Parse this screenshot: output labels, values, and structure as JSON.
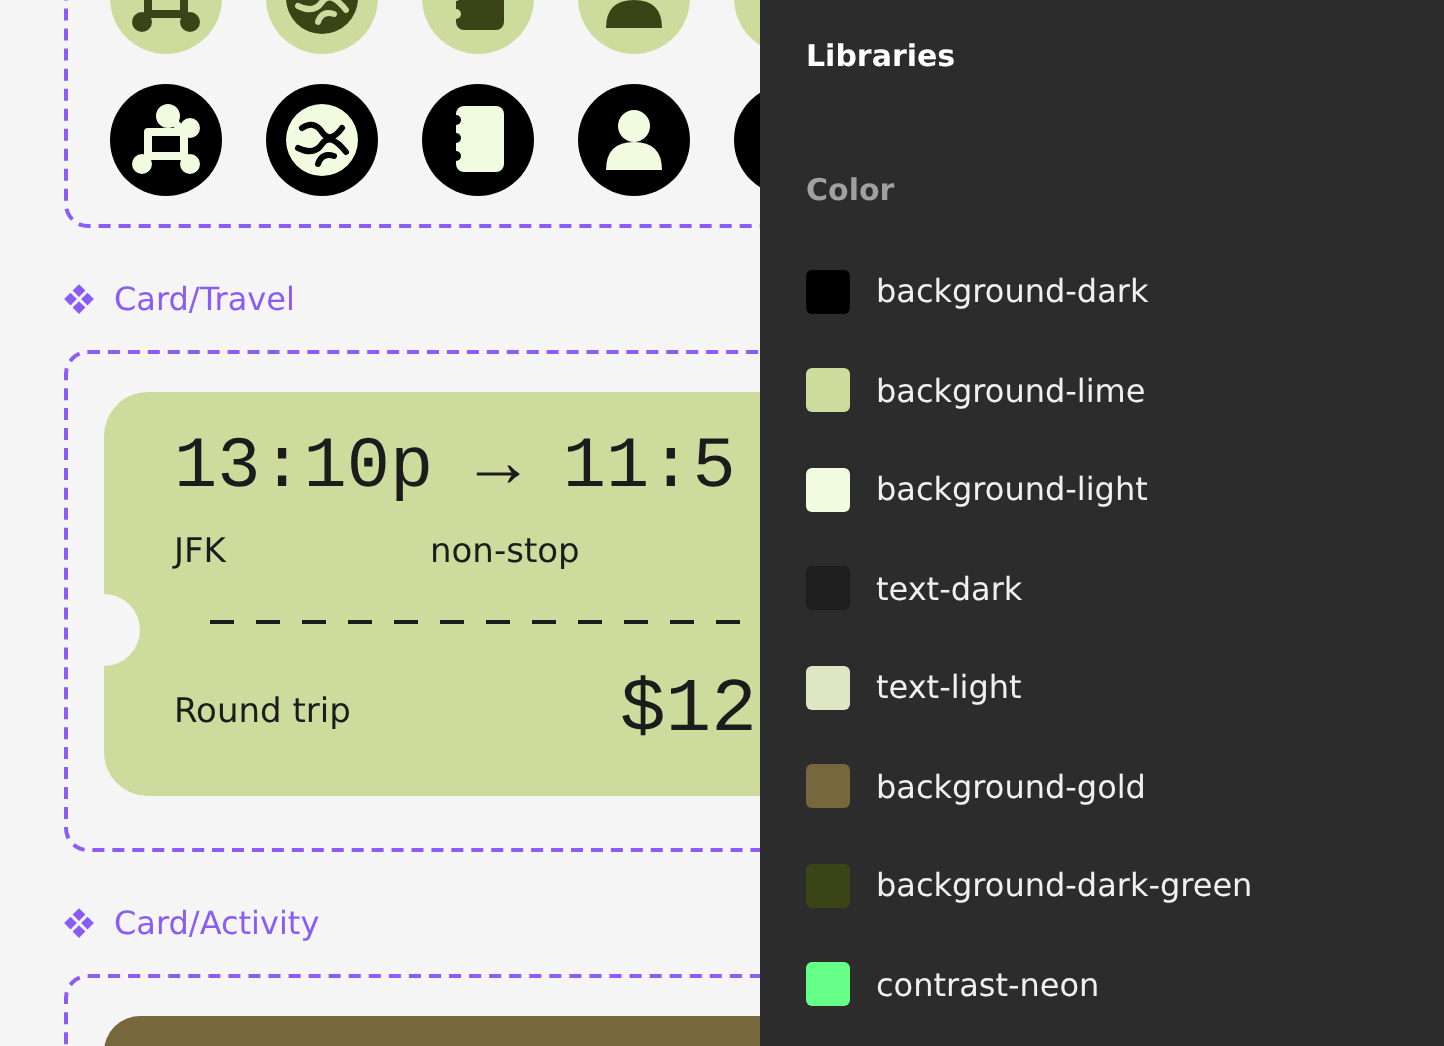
{
  "canvas": {
    "sections": [
      {
        "label": "Card/Travel",
        "kind": "travel",
        "card": {
          "times": "13:10p → 11:5",
          "origin": "JFK",
          "stops": "non-stop",
          "trip": "Round trip",
          "price": "$12"
        }
      },
      {
        "label": "Card/Activity",
        "kind": "activity"
      }
    ]
  },
  "panel": {
    "title": "Libraries",
    "section": "Color",
    "styles": [
      {
        "name": "background-dark",
        "color": "#000000"
      },
      {
        "name": "background-lime",
        "color": "#cddc9c"
      },
      {
        "name": "background-light",
        "color": "#f0fbe0"
      },
      {
        "name": "text-dark",
        "color": "#1e1e1e"
      },
      {
        "name": "text-light",
        "color": "#dfe6c4"
      },
      {
        "name": "background-gold",
        "color": "#76683c"
      },
      {
        "name": "background-dark-green",
        "color": "#3a4417"
      },
      {
        "name": "contrast-neon",
        "color": "#66ff88"
      }
    ]
  }
}
